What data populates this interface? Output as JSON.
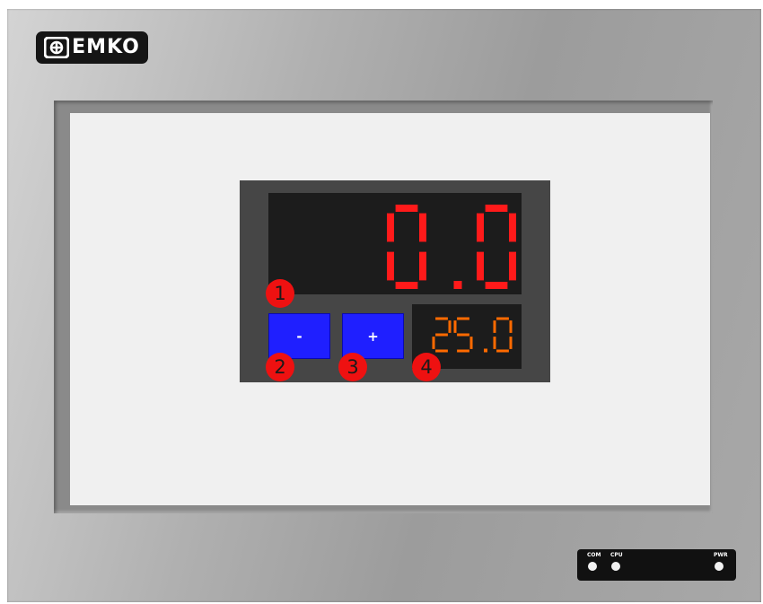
{
  "brand": {
    "name": "EMKO",
    "logo_icon": "emko-logo-icon"
  },
  "process_value": {
    "text": "0.0",
    "color": "#ff1a1a",
    "segment_off_color": "#3a0a0a"
  },
  "setpoint": {
    "text": "25.0",
    "color": "#ff6a00",
    "segment_off_color": "#3a1a00"
  },
  "buttons": {
    "decrease_label": "-",
    "increase_label": "+",
    "color": "#1f1fff"
  },
  "markers": [
    "1",
    "2",
    "3",
    "4"
  ],
  "status_leds": [
    {
      "label": "COM"
    },
    {
      "label": "CPU"
    },
    {
      "label": "PWR"
    }
  ]
}
